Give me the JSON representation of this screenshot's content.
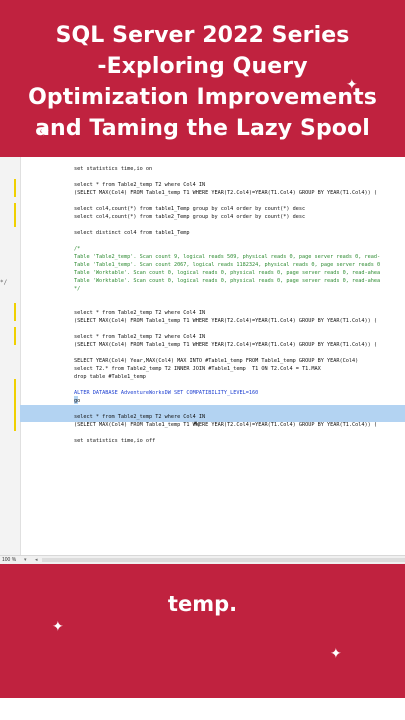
{
  "title": {
    "line1": "SQL Server 2022 Series",
    "line2": "-Exploring Query",
    "line3": "Optimization Improvements",
    "line4": "and Taming the Lazy Spool"
  },
  "editor": {
    "lines": [
      {
        "text": "set statistics time,io on",
        "cls": ""
      },
      {
        "text": "",
        "cls": ""
      },
      {
        "text": "select * from Table2_temp T2 where Col4 IN",
        "cls": ""
      },
      {
        "text": "(SELECT MAX(Col4) FROM Table1_temp T1 WHERE YEAR(T2.Col4)=YEAR(T1.Col4) GROUP BY YEAR(T1.Col4)) (",
        "cls": ""
      },
      {
        "text": "",
        "cls": ""
      },
      {
        "text": "select col4,count(*) from table1_Temp group by col4 order by count(*) desc",
        "cls": ""
      },
      {
        "text": "select col4,count(*) from table2_Temp group by col4 order by count(*) desc",
        "cls": ""
      },
      {
        "text": "",
        "cls": ""
      },
      {
        "text": "select distinct col4 from table1_Temp",
        "cls": ""
      },
      {
        "text": "",
        "cls": ""
      },
      {
        "text": "/*",
        "cls": "c-comment"
      },
      {
        "text": "Table 'Table2_temp'. Scan count 9, logical reads 509, physical reads 0, page server reads 0, read-",
        "cls": "c-comment"
      },
      {
        "text": "Table 'Table1_temp'. Scan count 2067, logical reads 1182324, physical reads 0, page server reads 0",
        "cls": "c-comment"
      },
      {
        "text": "Table 'Worktable'. Scan count 0, logical reads 0, physical reads 0, page server reads 0, read-ahea",
        "cls": "c-comment"
      },
      {
        "text": "Table 'Worktable'. Scan count 0, logical reads 0, physical reads 0, page server reads 0, read-ahea",
        "cls": "c-comment"
      },
      {
        "text": "*/",
        "cls": "c-comment"
      },
      {
        "text": "",
        "cls": ""
      },
      {
        "text": "",
        "cls": ""
      },
      {
        "text": "select * from Table2_temp T2 where Col4 IN",
        "cls": ""
      },
      {
        "text": "(SELECT MAX(Col4) FROM Table1_temp T1 WHERE YEAR(T2.Col4)=YEAR(T1.Col4) GROUP BY YEAR(T1.Col4)) (",
        "cls": ""
      },
      {
        "text": "",
        "cls": ""
      },
      {
        "text": "select * from Table2_temp T2 where Col4 IN",
        "cls": ""
      },
      {
        "text": "(SELECT MAX(Col4) FROM Table1_temp T1 WHERE YEAR(T2.Col4)=YEAR(T1.Col4) GROUP BY YEAR(T1.Col4)) (",
        "cls": ""
      },
      {
        "text": "",
        "cls": ""
      },
      {
        "text": "SELECT YEAR(Col4) Year,MAX(Col4) MAX INTO #Table1_temp FROM Table1_temp GROUP BY YEAR(Col4)",
        "cls": ""
      },
      {
        "text": "select T2.* from Table2_temp T2 INNER JOIN #Table1_temp  T1 ON T2.Col4 = T1.MAX",
        "cls": ""
      },
      {
        "text": "drop table #Table1_temp",
        "cls": ""
      },
      {
        "text": "",
        "cls": ""
      },
      {
        "text": "ALTER DATABASE AdventureWorksDW SET COMPATIBILITY_LEVEL=160",
        "cls": "c-kw"
      },
      {
        "text": "go",
        "cls": ""
      },
      {
        "text": "",
        "cls": ""
      },
      {
        "text": "select * from Table2_temp T2 where Col4 IN",
        "cls": ""
      },
      {
        "text": "(SELECT MAX(Col4) FROM Table1_temp T1 WHERE YEAR(T2.Col4)=YEAR(T1.Col4) GROUP BY YEAR(T1.Col4)) (",
        "cls": ""
      },
      {
        "text": "",
        "cls": ""
      },
      {
        "text": "set statistics time,io off",
        "cls": ""
      }
    ],
    "comment_marker": "*/"
  },
  "status": {
    "zoom": "100 %",
    "zoom_caret": "▾",
    "scroll_left": "◂"
  },
  "bottom_caption": "temp.",
  "colors": {
    "frame": "#c0223f",
    "selection": "#b3d3f2"
  }
}
